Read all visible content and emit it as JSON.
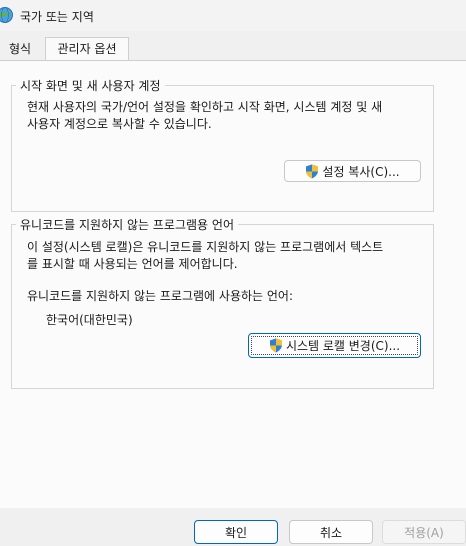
{
  "window": {
    "title": "국가 또는 지역",
    "icon": "globe-icon"
  },
  "tabs": [
    {
      "label": "형식",
      "active": false
    },
    {
      "label": "관리자 옵션",
      "active": true
    }
  ],
  "group_welcome": {
    "legend": "시작 화면 및 새 사용자 계정",
    "description_line1": "현재 사용자의 국가/언어 설정을 확인하고 시작 화면, 시스템 계정 및 새",
    "description_line2": "사용자 계정으로 복사할 수 있습니다.",
    "copy_button": "설정 복사(C)...",
    "copy_button_icon": "uac-shield-icon"
  },
  "group_nonunicode": {
    "legend": "유니코드를 지원하지 않는 프로그램용 언어",
    "description_line1": "이 설정(시스템 로캘)은 유니코드를 지원하지 않는 프로그램에서 텍스트",
    "description_line2": "를 표시할 때 사용되는 언어를 제어합니다.",
    "current_label": "유니코드를 지원하지 않는 프로그램에 사용하는 언어:",
    "current_value": "한국어(대한민국)",
    "change_button": "시스템 로캘 변경(C)...",
    "change_button_icon": "uac-shield-icon"
  },
  "footer": {
    "ok": "확인",
    "cancel": "취소",
    "apply": "적용(A)"
  },
  "colors": {
    "accent": "#0067c0",
    "panel": "#fbfbfb",
    "dialog_bg": "#f0f0f0"
  }
}
